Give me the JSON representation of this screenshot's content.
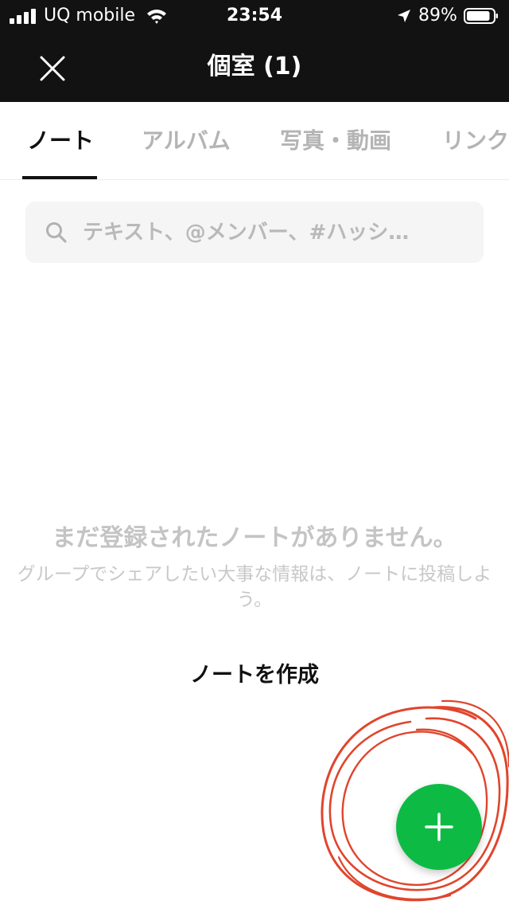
{
  "status_bar": {
    "carrier": "UQ mobile",
    "time": "23:54",
    "battery_percent": "89%",
    "battery_level": 0.89,
    "icons": [
      "signal-icon",
      "wifi-icon",
      "location-arrow-icon",
      "battery-icon"
    ]
  },
  "header": {
    "title": "個室 (1)",
    "close_icon": "close-icon"
  },
  "tabs": [
    {
      "label": "ノート",
      "active": true
    },
    {
      "label": "アルバム",
      "active": false
    },
    {
      "label": "写真・動画",
      "active": false
    },
    {
      "label": "リンク",
      "active": false
    }
  ],
  "search": {
    "placeholder": "テキスト、@メンバー、#ハッシ…",
    "value": "",
    "icon": "search-icon"
  },
  "empty_state": {
    "title": "まだ登録されたノートがありません。",
    "description": "グループでシェアしたい大事な情報は、ノートに投稿しよう。",
    "create_label": "ノートを作成"
  },
  "fab": {
    "icon": "plus-icon"
  },
  "colors": {
    "header_bg": "#121212",
    "accent_green": "#0dbb44",
    "annotation_red": "#e0452c",
    "inactive_tab": "#b4b4b4"
  }
}
